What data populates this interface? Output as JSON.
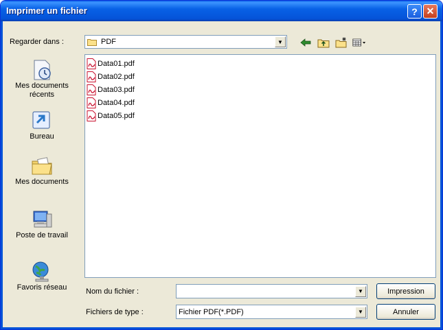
{
  "window": {
    "title": "Imprimer un fichier"
  },
  "lookin": {
    "label": "Regarder dans :",
    "value": "PDF"
  },
  "places": [
    {
      "label_line1": "Mes documents",
      "label_line2": "récents",
      "icon": "recent-docs-icon"
    },
    {
      "label_line1": "Bureau",
      "label_line2": "",
      "icon": "desktop-icon"
    },
    {
      "label_line1": "Mes documents",
      "label_line2": "",
      "icon": "my-documents-icon"
    },
    {
      "label_line1": "Poste de travail",
      "label_line2": "",
      "icon": "my-computer-icon"
    },
    {
      "label_line1": "Favoris réseau",
      "label_line2": "",
      "icon": "network-places-icon"
    }
  ],
  "files": [
    {
      "name": "Data01.pdf"
    },
    {
      "name": "Data02.pdf"
    },
    {
      "name": "Data03.pdf"
    },
    {
      "name": "Data04.pdf"
    },
    {
      "name": "Data05.pdf"
    }
  ],
  "filename": {
    "label": "Nom du fichier :",
    "value": ""
  },
  "filetype": {
    "label": "Fichiers de type :",
    "value": "Fichier PDF(*.PDF)"
  },
  "buttons": {
    "print": "Impression",
    "cancel": "Annuler"
  },
  "colors": {
    "title_bar": "#0553d8",
    "dialog_bg": "#ece9d8",
    "pdf_red": "#c8102e"
  }
}
